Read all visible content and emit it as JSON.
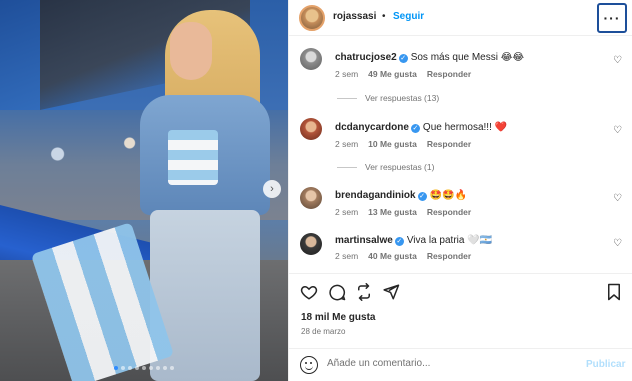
{
  "header": {
    "username": "rojassasi",
    "separator": "•",
    "follow_label": "Seguir",
    "more_icon": "more-horizontal-icon"
  },
  "comments": [
    {
      "username": "chatrucjose2",
      "verified": true,
      "text": "Sos más que Messi 😂😂",
      "time": "2 sem",
      "likes": "49 Me gusta",
      "reply_label": "Responder",
      "view_replies": "Ver respuestas (13)"
    },
    {
      "username": "dcdanycardone",
      "verified": true,
      "text": "Que hermosa!!! ❤️",
      "time": "2 sem",
      "likes": "10 Me gusta",
      "reply_label": "Responder",
      "view_replies": "Ver respuestas (1)"
    },
    {
      "username": "brendagandiniok",
      "verified": true,
      "text": "🤩🤩🔥",
      "time": "2 sem",
      "likes": "13 Me gusta",
      "reply_label": "Responder",
      "view_replies": ""
    },
    {
      "username": "martinsalwe",
      "verified": true,
      "text": "Viva la patria 🤍🇦🇷",
      "time": "2 sem",
      "likes": "40 Me gusta",
      "reply_label": "Responder",
      "view_replies": ""
    }
  ],
  "post": {
    "likes": "18 mil Me gusta",
    "date": "28 de marzo"
  },
  "composer": {
    "placeholder": "Añade un comentario...",
    "post_label": "Publicar"
  },
  "carousel": {
    "total_slides": 9,
    "active_slide": 1
  },
  "colors": {
    "accent": "#0095f6",
    "verified": "#3897f0",
    "heart": "#ed4956",
    "post_disabled": "#b2dffc"
  }
}
